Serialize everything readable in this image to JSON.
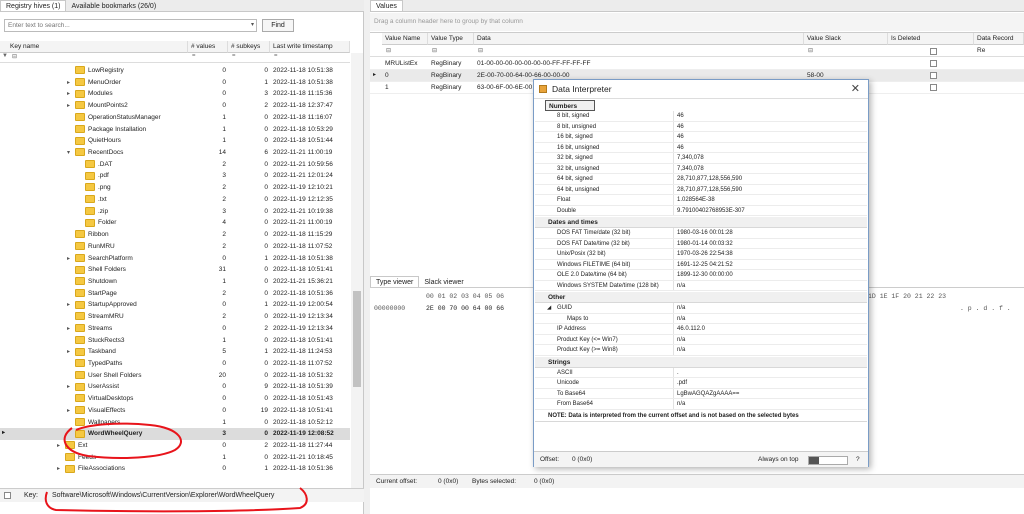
{
  "left_tabs": [
    "Registry hives (1)",
    "Available bookmarks (26/0)"
  ],
  "search": {
    "placeholder": "Enter text to search...",
    "find_label": "Find"
  },
  "tree_headers": [
    "Key name",
    "# values",
    "# subkeys",
    "Last write timestamp"
  ],
  "tree_rows": [
    {
      "indent": 75,
      "arrow": "",
      "name": "LowRegistry",
      "values": "0",
      "subkeys": "0",
      "ts": "2022-11-18 10:51:38"
    },
    {
      "indent": 75,
      "arrow": "▸",
      "name": "MenuOrder",
      "values": "0",
      "subkeys": "1",
      "ts": "2022-11-18 10:51:38"
    },
    {
      "indent": 75,
      "arrow": "▸",
      "name": "Modules",
      "values": "0",
      "subkeys": "3",
      "ts": "2022-11-18 11:15:36"
    },
    {
      "indent": 75,
      "arrow": "▸",
      "name": "MountPoints2",
      "values": "0",
      "subkeys": "2",
      "ts": "2022-11-18 12:37:47"
    },
    {
      "indent": 75,
      "arrow": "",
      "name": "OperationStatusManager",
      "values": "1",
      "subkeys": "0",
      "ts": "2022-11-18 11:16:07"
    },
    {
      "indent": 75,
      "arrow": "",
      "name": "Package Installation",
      "values": "1",
      "subkeys": "0",
      "ts": "2022-11-18 10:53:29"
    },
    {
      "indent": 75,
      "arrow": "",
      "name": "QuietHours",
      "values": "1",
      "subkeys": "0",
      "ts": "2022-11-18 10:51:44"
    },
    {
      "indent": 75,
      "arrow": "▾",
      "name": "RecentDocs",
      "values": "14",
      "subkeys": "6",
      "ts": "2022-11-21 11:00:19"
    },
    {
      "indent": 85,
      "arrow": "",
      "name": ".DAT",
      "values": "2",
      "subkeys": "0",
      "ts": "2022-11-21 10:59:56"
    },
    {
      "indent": 85,
      "arrow": "",
      "name": ".pdf",
      "values": "3",
      "subkeys": "0",
      "ts": "2022-11-21 12:01:24"
    },
    {
      "indent": 85,
      "arrow": "",
      "name": ".png",
      "values": "2",
      "subkeys": "0",
      "ts": "2022-11-19 12:10:21"
    },
    {
      "indent": 85,
      "arrow": "",
      "name": ".txt",
      "values": "2",
      "subkeys": "0",
      "ts": "2022-11-19 12:12:35"
    },
    {
      "indent": 85,
      "arrow": "",
      "name": ".zip",
      "values": "3",
      "subkeys": "0",
      "ts": "2022-11-21 10:19:38"
    },
    {
      "indent": 85,
      "arrow": "",
      "name": "Folder",
      "values": "4",
      "subkeys": "0",
      "ts": "2022-11-21 11:00:19"
    },
    {
      "indent": 75,
      "arrow": "",
      "name": "Ribbon",
      "values": "2",
      "subkeys": "0",
      "ts": "2022-11-18 11:15:29"
    },
    {
      "indent": 75,
      "arrow": "",
      "name": "RunMRU",
      "values": "2",
      "subkeys": "0",
      "ts": "2022-11-18 11:07:52"
    },
    {
      "indent": 75,
      "arrow": "▸",
      "name": "SearchPlatform",
      "values": "0",
      "subkeys": "1",
      "ts": "2022-11-18 10:51:38"
    },
    {
      "indent": 75,
      "arrow": "",
      "name": "Shell Folders",
      "values": "31",
      "subkeys": "0",
      "ts": "2022-11-18 10:51:41"
    },
    {
      "indent": 75,
      "arrow": "",
      "name": "Shutdown",
      "values": "1",
      "subkeys": "0",
      "ts": "2022-11-21 15:36:21"
    },
    {
      "indent": 75,
      "arrow": "",
      "name": "StartPage",
      "values": "2",
      "subkeys": "0",
      "ts": "2022-11-18 10:51:36"
    },
    {
      "indent": 75,
      "arrow": "▸",
      "name": "StartupApproved",
      "values": "0",
      "subkeys": "1",
      "ts": "2022-11-19 12:00:54"
    },
    {
      "indent": 75,
      "arrow": "",
      "name": "StreamMRU",
      "values": "2",
      "subkeys": "0",
      "ts": "2022-11-19 12:13:34"
    },
    {
      "indent": 75,
      "arrow": "▸",
      "name": "Streams",
      "values": "0",
      "subkeys": "2",
      "ts": "2022-11-19 12:13:34"
    },
    {
      "indent": 75,
      "arrow": "",
      "name": "StuckRects3",
      "values": "1",
      "subkeys": "0",
      "ts": "2022-11-18 10:51:41"
    },
    {
      "indent": 75,
      "arrow": "▸",
      "name": "Taskband",
      "values": "5",
      "subkeys": "1",
      "ts": "2022-11-18 11:24:53"
    },
    {
      "indent": 75,
      "arrow": "",
      "name": "TypedPaths",
      "values": "0",
      "subkeys": "0",
      "ts": "2022-11-18 11:07:52"
    },
    {
      "indent": 75,
      "arrow": "",
      "name": "User Shell Folders",
      "values": "20",
      "subkeys": "0",
      "ts": "2022-11-18 10:51:32"
    },
    {
      "indent": 75,
      "arrow": "▸",
      "name": "UserAssist",
      "values": "0",
      "subkeys": "9",
      "ts": "2022-11-18 10:51:39"
    },
    {
      "indent": 75,
      "arrow": "",
      "name": "VirtualDesktops",
      "values": "0",
      "subkeys": "0",
      "ts": "2022-11-18 10:51:43"
    },
    {
      "indent": 75,
      "arrow": "▸",
      "name": "VisualEffects",
      "values": "0",
      "subkeys": "19",
      "ts": "2022-11-18 10:51:41"
    },
    {
      "indent": 75,
      "arrow": "",
      "name": "Wallpapers",
      "values": "1",
      "subkeys": "0",
      "ts": "2022-11-18 10:52:12"
    },
    {
      "indent": 75,
      "arrow": "",
      "name": "WordWheelQuery",
      "values": "3",
      "subkeys": "0",
      "ts": "2022-11-19 12:08:52",
      "selected": true
    },
    {
      "indent": 65,
      "arrow": "▸",
      "name": "Ext",
      "values": "0",
      "subkeys": "2",
      "ts": "2022-11-18 11:27:44"
    },
    {
      "indent": 65,
      "arrow": "",
      "name": "Feeds",
      "values": "1",
      "subkeys": "0",
      "ts": "2022-11-21 10:18:45"
    },
    {
      "indent": 65,
      "arrow": "▸",
      "name": "FileAssociations",
      "values": "0",
      "subkeys": "1",
      "ts": "2022-11-18 10:51:36"
    }
  ],
  "key_label": "Key:",
  "key_path": "Software\\Microsoft\\Windows\\CurrentVersion\\Explorer\\WordWheelQuery",
  "values_tab": "Values",
  "group_hint": "Drag a column header here to group by that column",
  "values_headers": [
    "Value Name",
    "Value Type",
    "Data",
    "Value Slack",
    "Is Deleted",
    "Data Record Re"
  ],
  "values_rows": [
    {
      "name": "MRUListEx",
      "type": "RegBinary",
      "data": "01-00-00-00-00-00-00-00-FF-FF-FF-FF",
      "slack": ""
    },
    {
      "name": "0",
      "type": "RegBinary",
      "data": "2E-00-70-00-64-00-66-00-00-00",
      "slack": "58-00"
    },
    {
      "name": "1",
      "type": "RegBinary",
      "data": "63-00-6F-00-6E-00",
      "slack": ""
    }
  ],
  "viewer_tabs": [
    "Type viewer",
    "Slack viewer"
  ],
  "hex_header": "00 01 02 03 04 05 06",
  "hex_header_right": "1D 1E 1F 20 21 22 23",
  "hex_offset": "00000000",
  "hex_bytes": "2E 00 70 00 64 00 66",
  "hex_ascii": ". p . d . f .",
  "status": {
    "current_offset_label": "Current offset:",
    "current_offset": "0 (0x0)",
    "bytes_selected_label": "Bytes selected:",
    "bytes_selected": "0 (0x0)"
  },
  "interp": {
    "title": "Data Interpreter",
    "sections": [
      {
        "name": "Numbers",
        "rows": [
          [
            "8 bit, signed",
            "46"
          ],
          [
            "8 bit, unsigned",
            "46"
          ],
          [
            "16 bit, signed",
            "46"
          ],
          [
            "16 bit, unsigned",
            "46"
          ],
          [
            "32 bit, signed",
            "7,340,078"
          ],
          [
            "32 bit, unsigned",
            "7,340,078"
          ],
          [
            "64 bit, signed",
            "28,710,877,128,556,590"
          ],
          [
            "64 bit, unsigned",
            "28,710,877,128,556,590"
          ],
          [
            "Float",
            "1.028564E-38"
          ],
          [
            "Double",
            "9.79100402768953E-307"
          ]
        ]
      },
      {
        "name": "Dates and times",
        "rows": [
          [
            "DOS FAT Time/date (32 bit)",
            "1980-03-16 00:01:28"
          ],
          [
            "DOS FAT Date/time (32 bit)",
            "1980-01-14 00:03:32"
          ],
          [
            "Unix/Posix (32 bit)",
            "1970-03-26 22:54:38"
          ],
          [
            "Windows FILETIME (64 bit)",
            "1691-12-25 04:21:52"
          ],
          [
            "OLE 2.0 Date/time (64 bit)",
            "1899-12-30 00:00:00"
          ],
          [
            "Windows SYSTEM Date/time (128 bit)",
            "n/a"
          ]
        ]
      },
      {
        "name": "Other",
        "rows": [
          [
            "GUID",
            "n/a"
          ],
          [
            "Maps to",
            "n/a"
          ],
          [
            "IP Address",
            "46.0.112.0"
          ],
          [
            "Product Key (<= Win7)",
            "n/a"
          ],
          [
            "Product Key (>= Win8)",
            "n/a"
          ]
        ]
      },
      {
        "name": "Strings",
        "rows": [
          [
            "ASCII",
            "."
          ],
          [
            "Unicode",
            ".pdf"
          ],
          [
            "To Base64",
            "LgBwAGQAZgAAAA=="
          ],
          [
            "From Base64",
            "n/a"
          ]
        ]
      }
    ],
    "note": "NOTE: Data is interpreted from the current offset and is not based on the selected bytes",
    "offset_label": "Offset:",
    "offset_value": "0 (0x0)",
    "always_on_top": "Always on top",
    "help": "?"
  },
  "colors": {
    "select_row": "#dcdcdc",
    "annotation": "#e8141b",
    "accent": "#3d7ac4"
  }
}
